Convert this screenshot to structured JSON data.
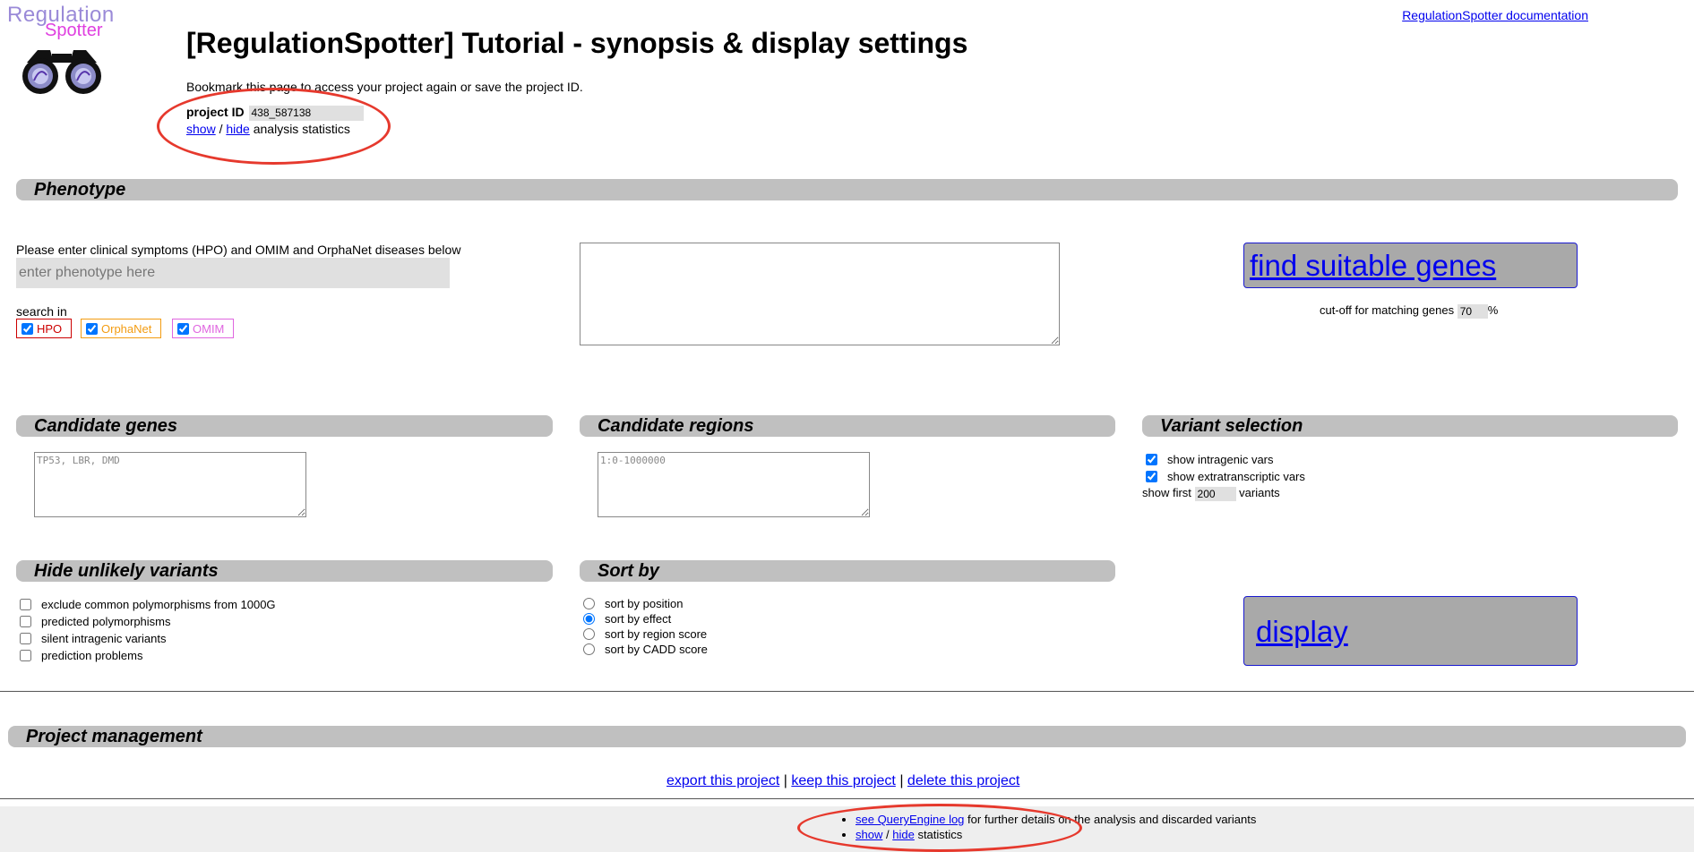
{
  "logo": {
    "line1": "Regulation",
    "line2": "Spotter"
  },
  "header": {
    "doc_link": "RegulationSpotter documentation",
    "title": "[RegulationSpotter] Tutorial - synopsis & display settings",
    "bookmark_text": "Bookmark this page to access your project again or save the project ID.",
    "project_id_label": "project ID",
    "project_id_value": "438_587138",
    "show_label": "show",
    "separator": "/",
    "hide_label": "hide",
    "stats_text": "analysis statistics"
  },
  "phenotype": {
    "section_title": "Phenotype",
    "instructions": "Please enter clinical symptoms (HPO) and OMIM and OrphaNet diseases below",
    "placeholder": "enter phenotype here",
    "search_in_label": "search in",
    "sources": [
      {
        "label": "HPO",
        "checked": true,
        "color": "#cc0000"
      },
      {
        "label": "OrphaNet",
        "checked": true,
        "color": "#f39c12"
      },
      {
        "label": "OMIM",
        "checked": true,
        "color": "#e066e0"
      }
    ],
    "find_button": "find suitable genes",
    "cutoff_label": "cut-off for matching genes",
    "cutoff_value": "70",
    "cutoff_unit": "%"
  },
  "candidate_genes": {
    "section_title": "Candidate genes",
    "placeholder": "TP53, LBR, DMD"
  },
  "candidate_regions": {
    "section_title": "Candidate regions",
    "placeholder": "1:0-1000000"
  },
  "variant_selection": {
    "section_title": "Variant selection",
    "options": [
      {
        "label": "show intragenic vars",
        "checked": true
      },
      {
        "label": "show extratranscriptic vars",
        "checked": true
      }
    ],
    "show_first_label": "show first",
    "show_first_value": "200",
    "variants_label": "variants"
  },
  "hide_unlikely": {
    "section_title": "Hide unlikely variants",
    "options": [
      {
        "label": "exclude common polymorphisms from 1000G",
        "checked": false
      },
      {
        "label": "predicted polymorphisms",
        "checked": false
      },
      {
        "label": "silent intragenic variants",
        "checked": false
      },
      {
        "label": "prediction problems",
        "checked": false
      }
    ]
  },
  "sort_by": {
    "section_title": "Sort by",
    "options": [
      {
        "label": "sort by position",
        "checked": false
      },
      {
        "label": "sort by effect",
        "checked": true
      },
      {
        "label": "sort by region score",
        "checked": false
      },
      {
        "label": "sort by CADD score",
        "checked": false
      }
    ]
  },
  "display_button": "display",
  "project_management": {
    "section_title": "Project management",
    "export": "export this project",
    "keep": "keep this project",
    "delete": "delete this project",
    "separator": "|"
  },
  "footer": {
    "log_link": "see QueryEngine log",
    "log_text": "for further details on the analysis and discarded variants",
    "show_label": "show",
    "separator": "/",
    "hide_label": "hide",
    "stats_text": "statistics"
  },
  "colors": {
    "accent_circle": "#e6392d",
    "section_bar": "#c0c0c0",
    "button_bg": "#a9a9a9",
    "link": "#0000ee"
  }
}
